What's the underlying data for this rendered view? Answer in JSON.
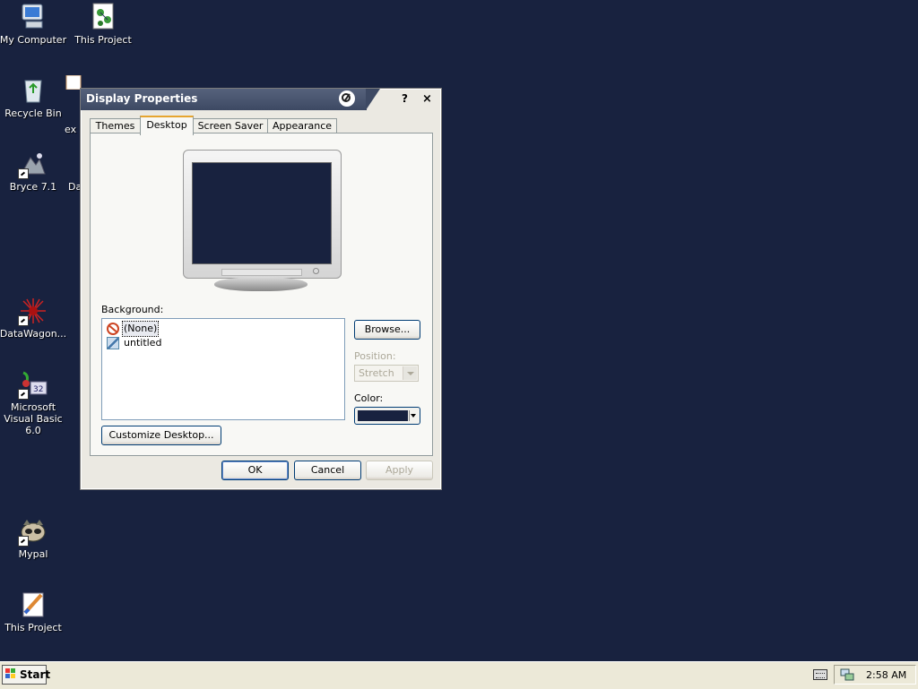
{
  "desktop": {
    "background_color": "#18223f",
    "icons": [
      {
        "label": "My Computer",
        "icon": "computer-icon"
      },
      {
        "label": "This Project",
        "icon": "molecule-icon"
      },
      {
        "label": "Recycle Bin",
        "icon": "recycle-bin-icon"
      },
      {
        "label": "Bryce 7.1",
        "icon": "bryce-icon"
      },
      {
        "label": "DataWagon...",
        "icon": "datawagon-icon"
      },
      {
        "label": "Microsoft Visual Basic 6.0",
        "icon": "visual-basic-icon"
      },
      {
        "label": "Mypal",
        "icon": "mypal-icon"
      },
      {
        "label": "This Project",
        "icon": "paintbrush-icon"
      },
      {
        "label": "ex",
        "icon": "document-icon"
      },
      {
        "label": "Da",
        "icon": "document-icon"
      }
    ]
  },
  "dialog": {
    "title": "Display Properties",
    "help_label": "?",
    "close_label": "×",
    "tabs": [
      {
        "label": "Themes",
        "active": false
      },
      {
        "label": "Desktop",
        "active": true
      },
      {
        "label": "Screen Saver",
        "active": false
      },
      {
        "label": "Appearance",
        "active": false
      }
    ],
    "background_label": "Background:",
    "background_items": [
      {
        "label": "(None)",
        "selected": true,
        "icon": "no-image-icon"
      },
      {
        "label": "untitled",
        "selected": false,
        "icon": "image-file-icon"
      }
    ],
    "browse_label": "Browse...",
    "position_label": "Position:",
    "position_value": "Stretch",
    "color_label": "Color:",
    "color_value": "#18223f",
    "customize_label": "Customize Desktop...",
    "ok_label": "OK",
    "cancel_label": "Cancel",
    "apply_label": "Apply"
  },
  "taskbar": {
    "start_label": "Start",
    "clock": "2:58 AM"
  }
}
